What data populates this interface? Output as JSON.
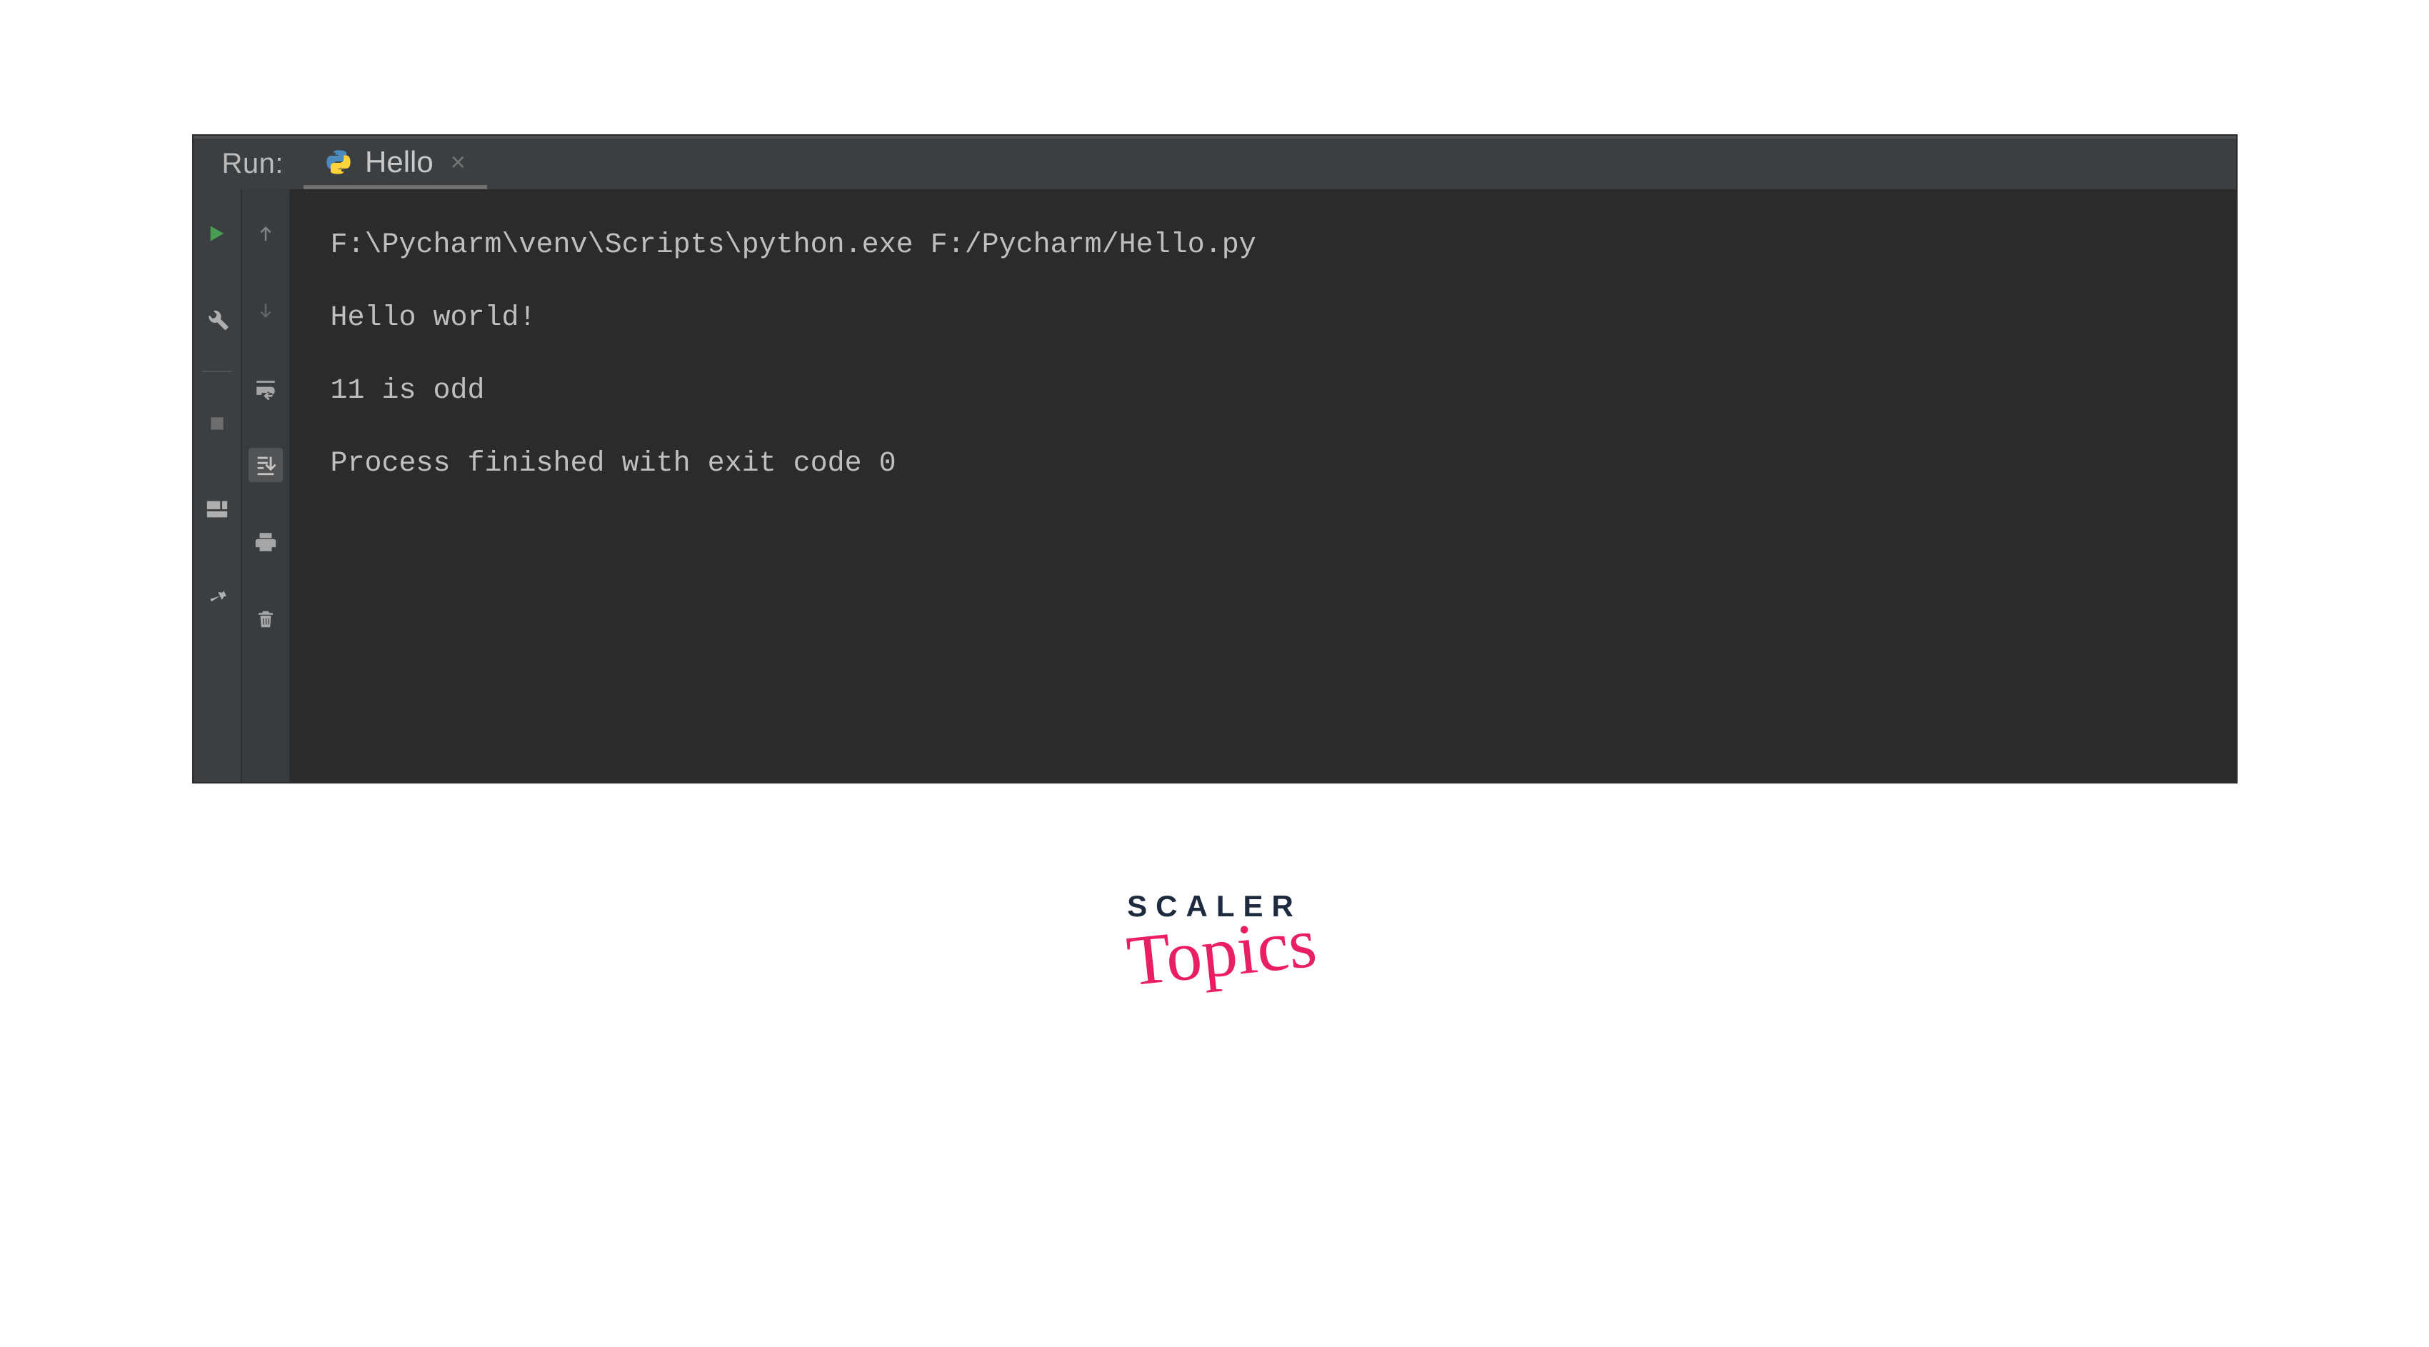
{
  "header": {
    "run_label": "Run:",
    "tab": {
      "title": "Hello",
      "close_glyph": "×"
    }
  },
  "left_toolbar": [
    {
      "name": "rerun-icon"
    },
    {
      "name": "wrench-icon"
    },
    {
      "name": "stop-icon"
    },
    {
      "name": "layout-icon"
    },
    {
      "name": "pin-icon"
    }
  ],
  "inner_toolbar": [
    {
      "name": "arrow-up-icon"
    },
    {
      "name": "arrow-down-icon"
    },
    {
      "name": "soft-wrap-icon"
    },
    {
      "name": "scroll-to-end-icon",
      "active": true
    },
    {
      "name": "print-icon"
    },
    {
      "name": "trash-icon"
    }
  ],
  "console": {
    "lines": [
      "F:\\Pycharm\\venv\\Scripts\\python.exe F:/Pycharm/Hello.py",
      "Hello world!",
      "11 is odd",
      "",
      "Process finished with exit code 0"
    ]
  },
  "watermark": {
    "line1": "SCALER",
    "line2": "Topics"
  },
  "colors": {
    "bg_dark": "#2b2b2b",
    "bg_panel": "#3c3f41",
    "text": "#bfbfbf",
    "run_green": "#499c54",
    "icon_grey": "#afafaf",
    "accent_pink": "#e91e63",
    "brand_navy": "#1e2a3d"
  }
}
